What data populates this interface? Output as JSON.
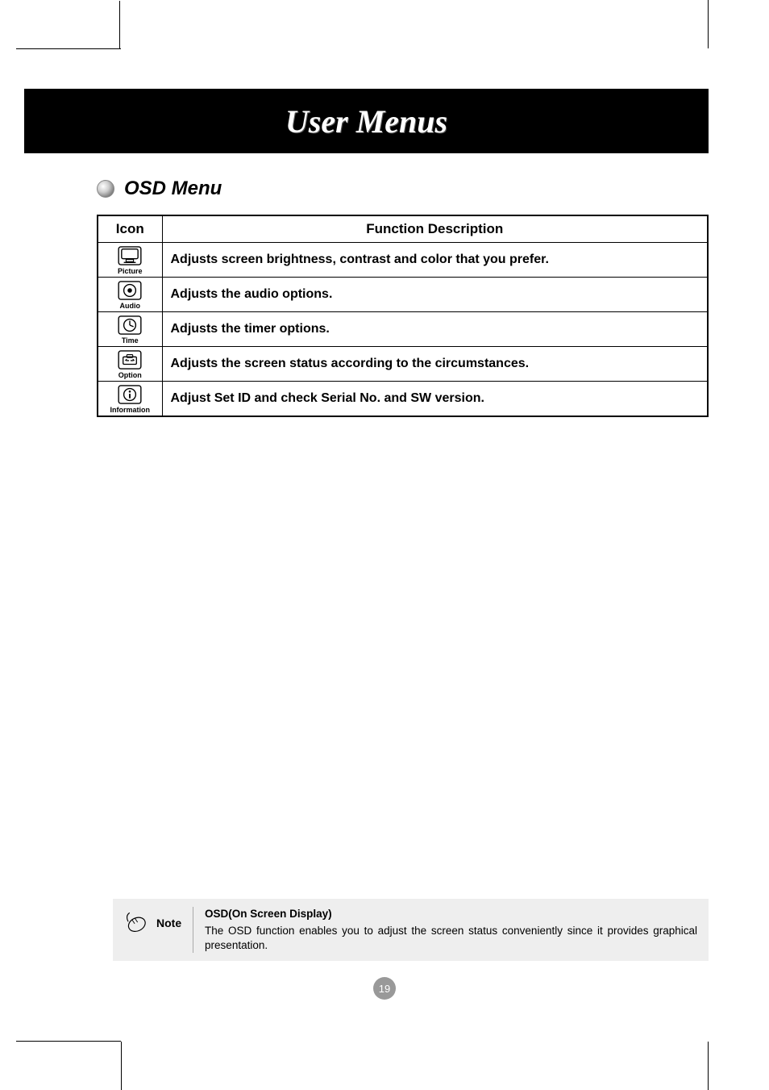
{
  "header": {
    "title": "User Menus"
  },
  "section": {
    "title": "OSD Menu"
  },
  "table": {
    "headers": {
      "icon": "Icon",
      "desc": "Function Description"
    },
    "rows": [
      {
        "icon_name": "picture-icon",
        "label": "Picture",
        "desc": "Adjusts screen brightness, contrast and color  that you prefer."
      },
      {
        "icon_name": "audio-icon",
        "label": "Audio",
        "desc": "Adjusts the audio options."
      },
      {
        "icon_name": "time-icon",
        "label": "Time",
        "desc": "Adjusts the timer options."
      },
      {
        "icon_name": "option-icon",
        "label": "Option",
        "desc": "Adjusts the screen status according to the circumstances."
      },
      {
        "icon_name": "information-icon",
        "label": "Information",
        "desc": "Adjust Set ID and check Serial No. and SW version."
      }
    ]
  },
  "note": {
    "label": "Note",
    "title": "OSD(On Screen Display)",
    "text": "The OSD function enables you to adjust the screen status conveniently since it provides graphical presentation."
  },
  "page_number": "19"
}
